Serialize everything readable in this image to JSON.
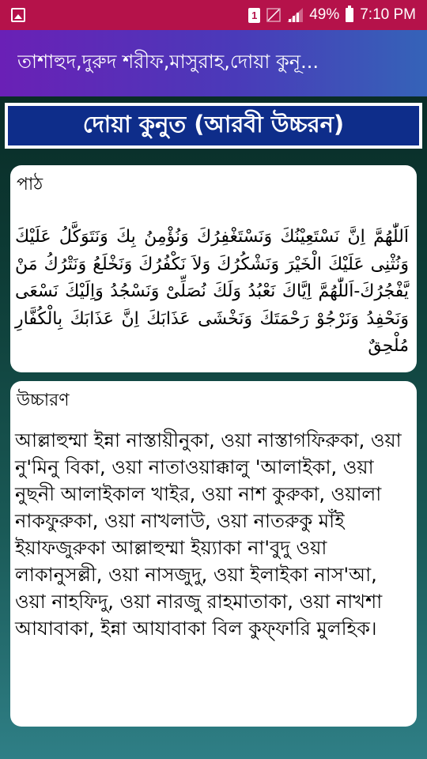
{
  "status_bar": {
    "sim_number": "1",
    "battery_percent": "49%",
    "time": "7:10 PM"
  },
  "app_bar": {
    "title": "তাশাহুদ,দুরুদ শরীফ,মাসুরাহ,দোয়া কুনূ..."
  },
  "section": {
    "title": "দোয়া কুনুত (আরবী উচ্চরন)"
  },
  "path_card": {
    "label": "পাঠ",
    "arabic": "اَللّٰهُمَّ اِنَّ نَسْتَعِيْنُكَ وَنَسْتَغْفِرُكَ وَنُؤْمِنُ بِكَ وَنَتَوَكَّلُ عَلَيْكَ وَنُثْنِى عَلَيْكَ الْخَيْرَ وَنَشْكُرُكَ وَلاَ نَكْفُرُكَ وَنَخْلَعُ وَنَتْرُكُ مَنْ يَّفْجُرُكَ-اَللّٰهُمَّ اِيَّاكَ نَعْبُدُ وَلَكَ نُصَلِّىْ وَنَسْجُدُ وَاِلَيْكَ نَسْعَى وَنَحْفِدُ وَنَرْجُوْ رَحْمَتَكَ وَنَخْشَى عَذَابَكَ اِنَّ عَذَابَكَ بِالْكُفَّارِ مُلْحِقٌ"
  },
  "pronunciation_card": {
    "label": "উচ্চারণ",
    "text": "আল্লাহুম্মা ইন্না নাস্তায়ীনুকা, ওয়া নাস্তাগফিরুকা, ওয়া নু'মিনু বিকা, ওয়া নাতাওয়াক্কালু 'আলাইকা, ওয়া নুছনী আলাইকাল খাইর, ওয়া নাশ কুরুকা, ওয়ালা নাকফুরুকা, ওয়া নাখলাউ, ওয়া নাতরুকু মাঁই ইয়াফজুরুকা আল্লাহুম্মা ইয়্যাকা না'বুদু ওয়া লাকানুসল্লী, ওয়া নাসজুদু, ওয়া ইলাইকা নাস'আ, ওয়া নাহফিদু, ওয়া নারজু রাহমাতাকা, ওয়া নাখশা আযাবাকা, ইন্না আযাবাকা বিল কুফ্ফারি মুলহিক।"
  }
}
